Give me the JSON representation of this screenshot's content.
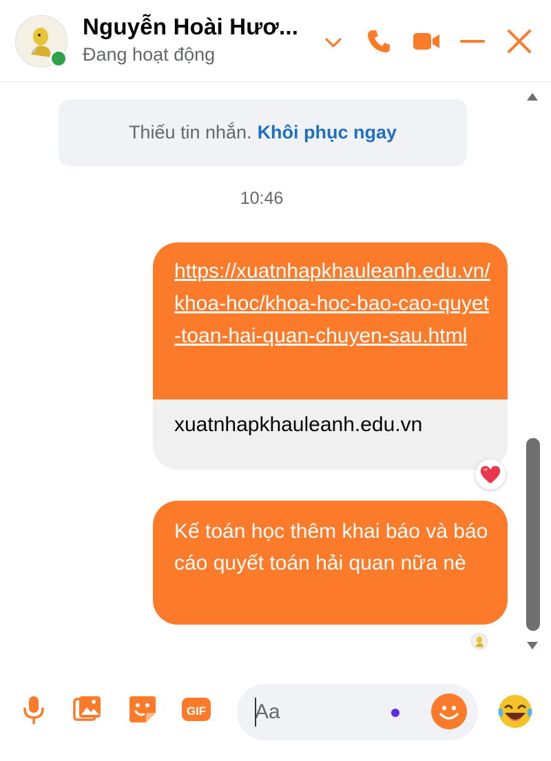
{
  "header": {
    "contact_name": "Nguyễn Hoài Hươ...",
    "status": "Đang hoạt động"
  },
  "notice": {
    "text": "Thiếu tin nhắn.",
    "link": "Khôi phục ngay"
  },
  "timestamp": "10:46",
  "messages": {
    "link_message": {
      "url": "https://xuatnhapkhauleanh.edu.vn/khoa-hoc/khoa-hoc-bao-cao-quyet-toan-hai-quan-chuyen-sau.html",
      "domain": "xuatnhapkhauleanh.edu.vn",
      "reaction": "heart"
    },
    "text_message": "Kế toán học thêm khai báo và báo cáo quyết toán hải quan nữa nè"
  },
  "composer": {
    "placeholder": "Aa"
  },
  "colors": {
    "accent": "#fb7b2a",
    "link_blue": "#1f6fc5",
    "online": "#31a24c"
  }
}
